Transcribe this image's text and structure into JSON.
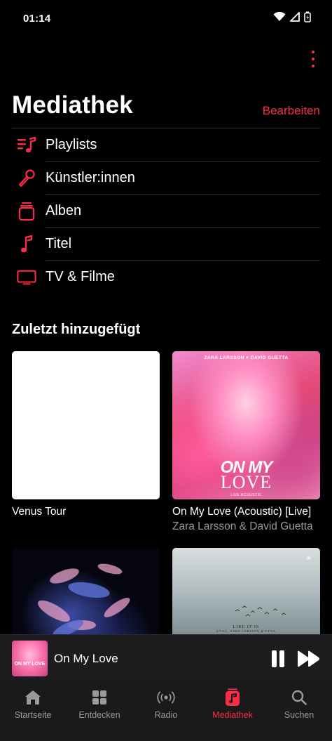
{
  "status_bar": {
    "time": "01:14"
  },
  "header": {
    "title": "Mediathek",
    "edit_label": "Bearbeiten"
  },
  "library_items": [
    {
      "label": "Playlists",
      "icon": "playlists-icon"
    },
    {
      "label": "Künstler:innen",
      "icon": "microphone-icon"
    },
    {
      "label": "Alben",
      "icon": "album-stack-icon"
    },
    {
      "label": "Titel",
      "icon": "music-note-icon"
    },
    {
      "label": "TV & Filme",
      "icon": "tv-icon"
    }
  ],
  "recently_added": {
    "title": "Zuletzt hinzugefügt",
    "albums": [
      {
        "title": "Venus Tour",
        "artist": ""
      },
      {
        "title": "On My Love (Acoustic) [Live]",
        "artist": "Zara Larsson & David Guetta",
        "cover_top": "ZARA LARSSON × DAVID GUETTA",
        "cover_big1": "ON MY",
        "cover_big2": "LOVE",
        "cover_sub": "LIVE ACOUSTIC"
      },
      {
        "title": "",
        "artist": ""
      },
      {
        "title": "",
        "artist": "",
        "cover_text": "LIKE IT IS",
        "cover_subtext": "KYGO, ZARA LARSSON & TYGA",
        "cover_mark": "✳"
      }
    ]
  },
  "now_playing": {
    "title": "On My Love",
    "art_text": "ON MY LOVE"
  },
  "tabs": [
    {
      "label": "Startseite",
      "icon": "home-icon",
      "active": false
    },
    {
      "label": "Entdecken",
      "icon": "grid-icon",
      "active": false
    },
    {
      "label": "Radio",
      "icon": "radio-icon",
      "active": false
    },
    {
      "label": "Mediathek",
      "icon": "library-icon",
      "active": true
    },
    {
      "label": "Suchen",
      "icon": "search-icon",
      "active": false
    }
  ],
  "colors": {
    "accent": "#fa2d48",
    "background": "#000000",
    "secondary_text": "#9a9a9e"
  }
}
